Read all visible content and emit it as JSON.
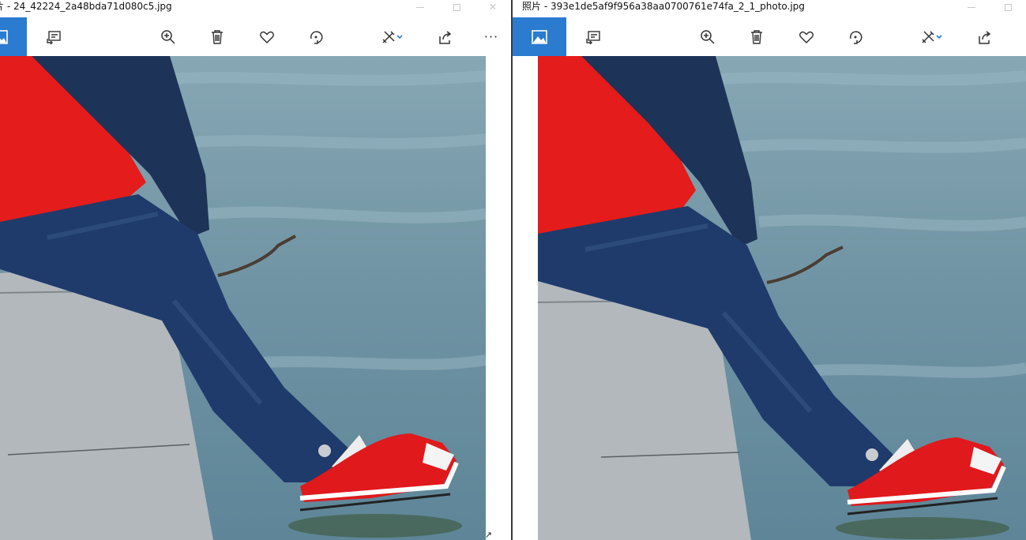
{
  "windows": [
    {
      "title": "片 - 24_42224_2a48bda71d080c5.jpg",
      "toolbar": {
        "view": "view-photo-icon",
        "slideshow": "slideshow-icon",
        "zoom": "zoom-in-icon",
        "delete": "delete-icon",
        "favorite": "heart-icon",
        "rotate": "rotate-icon",
        "edit": "edit-create-icon",
        "share": "share-icon",
        "more_label": "···"
      },
      "photo_alt": "Close-up of a person sitting on a stone ledge over water, wearing dark blue jeans and red canvas sneakers"
    },
    {
      "title": "照片 - 393e1de5af9f956a38aa0700761e74fa_2_1_photo.jpg",
      "toolbar": {
        "view": "view-photo-icon",
        "slideshow": "slideshow-icon",
        "zoom": "zoom-in-icon",
        "delete": "delete-icon",
        "favorite": "heart-icon",
        "rotate": "rotate-icon",
        "edit": "edit-create-icon",
        "share": "share-icon"
      },
      "photo_alt": "Close-up of a person sitting on a stone ledge over water, wearing dark blue jeans and red canvas sneakers"
    }
  ],
  "colors": {
    "accent": "#2b7bd0",
    "water": "#6f93a3",
    "shirt_red": "#e41c1c",
    "jeans": "#1f3b6b",
    "stone": "#b3b8bc"
  }
}
